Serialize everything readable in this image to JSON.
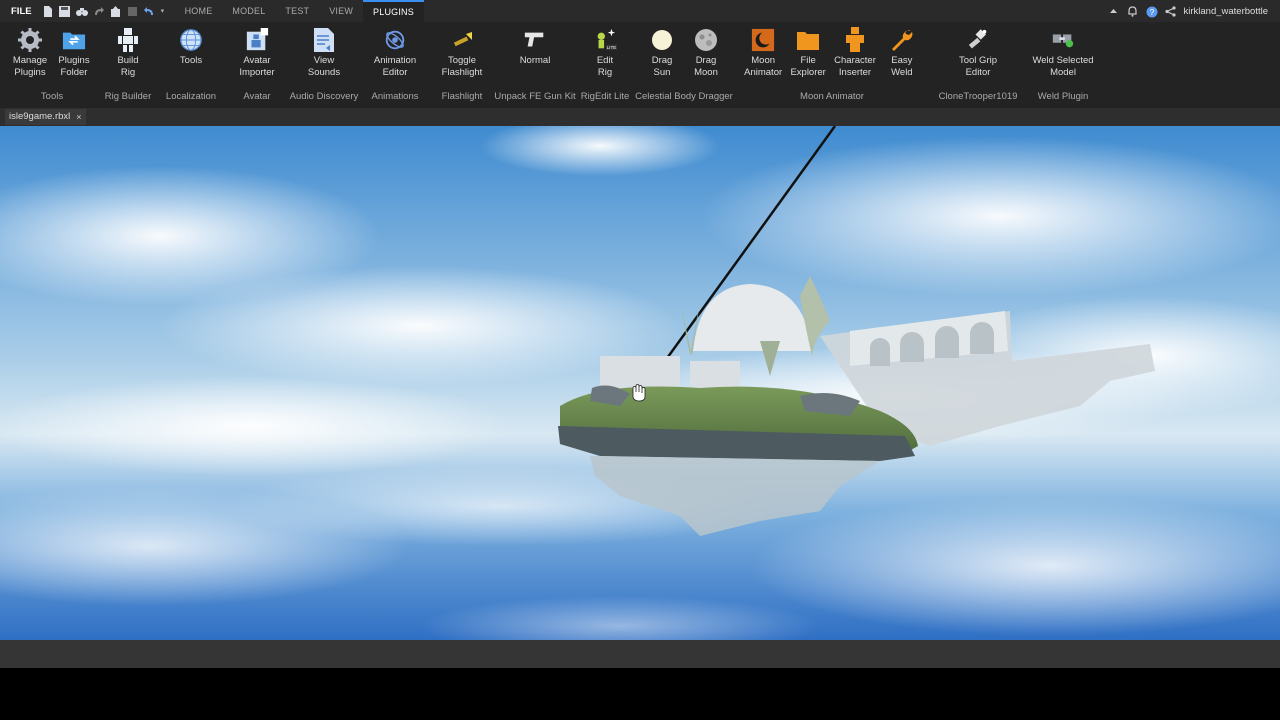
{
  "menu": {
    "file_label": "FILE",
    "tabs": [
      {
        "label": "HOME"
      },
      {
        "label": "MODEL"
      },
      {
        "label": "TEST"
      },
      {
        "label": "VIEW"
      },
      {
        "label": "PLUGINS"
      }
    ],
    "active_tab": "PLUGINS",
    "username": "kirkland_waterbottle"
  },
  "ribbon": {
    "groups": [
      {
        "label": "Tools",
        "buttons": [
          {
            "label": "Manage\nPlugins",
            "icon": "gear-icon"
          },
          {
            "label": "Plugins\nFolder",
            "icon": "folder-icon"
          }
        ]
      },
      {
        "label": "Rig Builder",
        "buttons": [
          {
            "label": "Build\nRig",
            "icon": "rig-figure-icon"
          }
        ]
      },
      {
        "label": "Localization",
        "buttons": [
          {
            "label": "Tools",
            "icon": "globe-icon"
          }
        ]
      },
      {
        "label": "Avatar",
        "buttons": [
          {
            "label": "Avatar\nImporter",
            "icon": "avatar-importer-icon"
          }
        ]
      },
      {
        "label": "Audio Discovery",
        "buttons": [
          {
            "label": "View\nSounds",
            "icon": "sound-document-icon"
          }
        ]
      },
      {
        "label": "Animations",
        "buttons": [
          {
            "label": "Animation\nEditor",
            "icon": "animation-editor-icon"
          }
        ]
      },
      {
        "label": "Flashlight",
        "buttons": [
          {
            "label": "Toggle\nFlashlight",
            "icon": "flashlight-icon"
          }
        ]
      },
      {
        "label": "Unpack FE Gun Kit",
        "buttons": [
          {
            "label": "Normal",
            "icon": "gun-icon"
          }
        ]
      },
      {
        "label": "RigEdit Lite",
        "buttons": [
          {
            "label": "Edit\nRig",
            "icon": "edit-rig-icon"
          }
        ]
      },
      {
        "label": "Celestial Body Dragger",
        "buttons": [
          {
            "label": "Drag\nSun",
            "icon": "sun-icon"
          },
          {
            "label": "Drag\nMoon",
            "icon": "moon-icon"
          }
        ]
      },
      {
        "label": "Moon Animator",
        "buttons": [
          {
            "label": "Moon\nAnimator",
            "icon": "moon-animator-icon"
          },
          {
            "label": "File\nExplorer",
            "icon": "file-explorer-icon"
          },
          {
            "label": "Character\nInserter",
            "icon": "character-inserter-icon"
          },
          {
            "label": "Easy\nWeld",
            "icon": "wrench-icon"
          }
        ]
      },
      {
        "label": "CloneTrooper1019",
        "buttons": [
          {
            "label": "Tool Grip\nEditor",
            "icon": "tool-grip-icon"
          }
        ]
      },
      {
        "label": "Weld Plugin",
        "buttons": [
          {
            "label": "Weld Selected\nModel",
            "icon": "weld-model-icon"
          }
        ]
      }
    ]
  },
  "document": {
    "tab_name": "isle9game.rbxl",
    "close_symbol": "×"
  }
}
